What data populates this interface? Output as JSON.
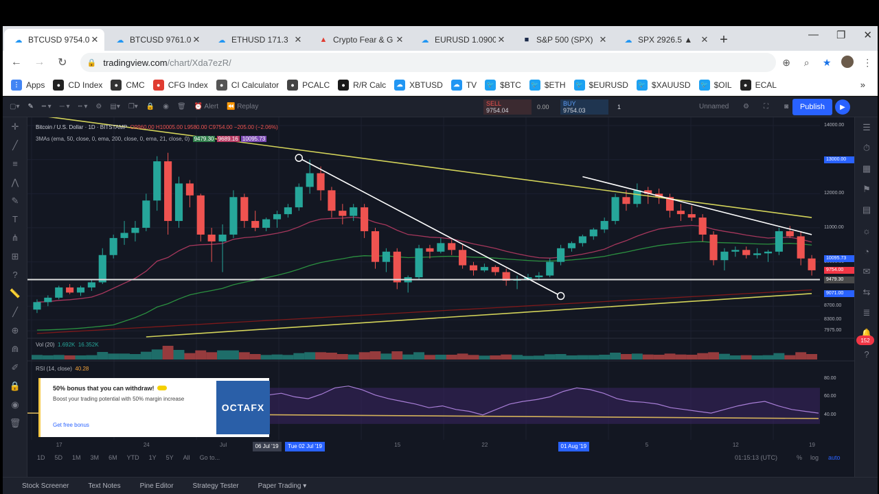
{
  "browser": {
    "tabs": [
      {
        "label": "BTCUSD 9754.0",
        "icon": "tradingview-icon",
        "active": true
      },
      {
        "label": "BTCUSD 9761.0",
        "icon": "tradingview-icon"
      },
      {
        "label": "ETHUSD 171.3",
        "icon": "tradingview-icon"
      },
      {
        "label": "Crypto Fear & G",
        "icon": "alternative-me-icon"
      },
      {
        "label": "EURUSD 1.0900",
        "icon": "tradingview-icon"
      },
      {
        "label": "S&P 500 (SPX)",
        "icon": "investing-icon"
      },
      {
        "label": "SPX 2926.5 ▲",
        "icon": "tradingview-icon"
      }
    ],
    "url_host": "tradingview.com",
    "url_path": "/chart/Xda7ezR/",
    "bookmarks": [
      {
        "label": "Apps",
        "icon": "apps-grid-icon",
        "color": "#4285f4"
      },
      {
        "label": "CD Index",
        "icon": "cd-index-icon",
        "color": "#222222"
      },
      {
        "label": "CMC",
        "icon": "coinmarketcap-icon",
        "color": "#333333"
      },
      {
        "label": "CFG Index",
        "icon": "cfg-index-icon",
        "color": "#e03c31"
      },
      {
        "label": "CI Calculator",
        "icon": "ci-calculator-icon",
        "color": "#555555"
      },
      {
        "label": "PCALC",
        "icon": "percent-icon",
        "color": "#444444"
      },
      {
        "label": "R/R Calc",
        "icon": "rr-calc-icon",
        "color": "#1a1a1a"
      },
      {
        "label": "XBTUSD",
        "icon": "tradingview-icon",
        "color": "#2196f3"
      },
      {
        "label": "TV",
        "icon": "tradingview-icon",
        "color": "#2196f3"
      },
      {
        "label": "$BTC",
        "icon": "twitter-icon",
        "color": "#1da1f2"
      },
      {
        "label": "$ETH",
        "icon": "twitter-icon",
        "color": "#1da1f2"
      },
      {
        "label": "$EURUSD",
        "icon": "twitter-icon",
        "color": "#1da1f2"
      },
      {
        "label": "$XAUUSD",
        "icon": "twitter-icon",
        "color": "#1da1f2"
      },
      {
        "label": "$OIL",
        "icon": "twitter-icon",
        "color": "#1da1f2"
      },
      {
        "label": "ECAL",
        "icon": "ecal-icon",
        "color": "#222222"
      }
    ]
  },
  "tv": {
    "toolbar": {
      "alert_label": "Alert",
      "replay_label": "Replay",
      "sell_label": "SELL",
      "sell_price": "9754.04",
      "spread": "0.00",
      "buy_label": "BUY",
      "buy_price": "9754.03",
      "qty": "1",
      "unnamed_label": "Unnamed",
      "publish_label": "Publish"
    },
    "legend": {
      "symbol": "Bitcoin / U.S. Dollar · 1D · BITSTAMP",
      "ohlc": "O9960.00  H10005.00  L9580.00  C9754.00  −205.00 (−2.06%)",
      "mas": "3MAs (ema, 50, close, 0, ema, 200, close, 0, ema, 21, close, 0)",
      "ma_values": [
        "9479.30",
        "9689.16",
        "10095.73"
      ]
    },
    "volume": {
      "label": "Vol (20)",
      "v1": "1.692K",
      "v2": "16.352K"
    },
    "rsi": {
      "label": "RSI (14, close)",
      "value": "40.28"
    },
    "ad": {
      "title": "50% bonus that you can withdraw!",
      "body": "Boost your trading potential with 50% margin increase",
      "link": "Get free bonus",
      "logo": "OCTAFX"
    },
    "price_axis": [
      "14000.00",
      "13000.00",
      "12000.00",
      "11000.00",
      "10000.00",
      "9000.00",
      "8700.00",
      "8300.00",
      "7975.00"
    ],
    "price_badges": [
      {
        "label": "13000.00",
        "color": "#2962ff"
      },
      {
        "label": "10095.73",
        "color": "#2962ff"
      },
      {
        "label": "9754.00",
        "color": "#f23645"
      },
      {
        "label": "9479.30",
        "color": "#4a4a4a"
      },
      {
        "label": "9071.00",
        "color": "#2962ff"
      }
    ],
    "rsi_axis": [
      "80.00",
      "60.00",
      "40.00"
    ],
    "time_axis": [
      "17",
      "24",
      "Jul",
      "8",
      "15",
      "22",
      "29",
      "5",
      "12",
      "19"
    ],
    "time_highlights": [
      "06 Jul '19",
      "Tue 02 Jul '19",
      "01 Aug '19"
    ],
    "ranges": [
      "1D",
      "5D",
      "1M",
      "3M",
      "6M",
      "YTD",
      "1Y",
      "5Y",
      "All",
      "Go to..."
    ],
    "clock": "01:15:13 (UTC)",
    "scale_modes": [
      "%",
      "log",
      "auto"
    ],
    "notification_count": "152",
    "footer_tabs": [
      "Stock Screener",
      "Text Notes",
      "Pine Editor",
      "Strategy Tester",
      "Paper Trading ▾"
    ]
  },
  "chart_data": {
    "type": "candlestick",
    "symbol": "Bitcoin / U.S. Dollar",
    "interval": "1D",
    "exchange": "BITSTAMP",
    "ylim": [
      7800,
      14200
    ],
    "colors": {
      "up": "#26a69a",
      "down": "#ef5350",
      "trendline": "#ffffff",
      "channel": "#d4d45a"
    },
    "candles": [
      {
        "o": 8600,
        "h": 8900,
        "l": 8500,
        "c": 8820
      },
      {
        "o": 8820,
        "h": 9020,
        "l": 8700,
        "c": 8950
      },
      {
        "o": 8950,
        "h": 9300,
        "l": 8900,
        "c": 9250
      },
      {
        "o": 9250,
        "h": 9350,
        "l": 9050,
        "c": 9100
      },
      {
        "o": 9100,
        "h": 9300,
        "l": 9000,
        "c": 9250
      },
      {
        "o": 9250,
        "h": 9500,
        "l": 9150,
        "c": 9400
      },
      {
        "o": 9400,
        "h": 10400,
        "l": 9350,
        "c": 10200
      },
      {
        "o": 10200,
        "h": 10800,
        "l": 10100,
        "c": 10700
      },
      {
        "o": 10700,
        "h": 11200,
        "l": 10500,
        "c": 10850
      },
      {
        "o": 10850,
        "h": 11200,
        "l": 10600,
        "c": 11000
      },
      {
        "o": 11000,
        "h": 12000,
        "l": 10900,
        "c": 11800
      },
      {
        "o": 11800,
        "h": 13100,
        "l": 11500,
        "c": 12950
      },
      {
        "o": 12950,
        "h": 13200,
        "l": 10800,
        "c": 11200
      },
      {
        "o": 11200,
        "h": 12500,
        "l": 11000,
        "c": 12300
      },
      {
        "o": 12300,
        "h": 12400,
        "l": 11600,
        "c": 11950
      },
      {
        "o": 11950,
        "h": 12000,
        "l": 10600,
        "c": 10800
      },
      {
        "o": 10800,
        "h": 11000,
        "l": 10000,
        "c": 10600
      },
      {
        "o": 10600,
        "h": 11100,
        "l": 9700,
        "c": 10800
      },
      {
        "o": 10800,
        "h": 12100,
        "l": 10700,
        "c": 11900
      },
      {
        "o": 11900,
        "h": 12000,
        "l": 11000,
        "c": 11200
      },
      {
        "o": 11200,
        "h": 11500,
        "l": 10900,
        "c": 11000
      },
      {
        "o": 11000,
        "h": 11300,
        "l": 10900,
        "c": 11250
      },
      {
        "o": 11250,
        "h": 11500,
        "l": 11000,
        "c": 11400
      },
      {
        "o": 11400,
        "h": 11700,
        "l": 11300,
        "c": 11600
      },
      {
        "o": 11600,
        "h": 12300,
        "l": 11500,
        "c": 12200
      },
      {
        "o": 12200,
        "h": 13000,
        "l": 12000,
        "c": 12600
      },
      {
        "o": 12600,
        "h": 12800,
        "l": 11800,
        "c": 12100
      },
      {
        "o": 12100,
        "h": 12200,
        "l": 11300,
        "c": 11500
      },
      {
        "o": 11500,
        "h": 11700,
        "l": 11100,
        "c": 11350
      },
      {
        "o": 11350,
        "h": 11700,
        "l": 11200,
        "c": 11600
      },
      {
        "o": 11600,
        "h": 11700,
        "l": 10700,
        "c": 10900
      },
      {
        "o": 10900,
        "h": 11000,
        "l": 9800,
        "c": 10000
      },
      {
        "o": 10000,
        "h": 10400,
        "l": 9700,
        "c": 10300
      },
      {
        "o": 10300,
        "h": 10400,
        "l": 9200,
        "c": 9400
      },
      {
        "o": 9400,
        "h": 9600,
        "l": 9100,
        "c": 9550
      },
      {
        "o": 9550,
        "h": 10500,
        "l": 9500,
        "c": 10400
      },
      {
        "o": 10400,
        "h": 10500,
        "l": 10100,
        "c": 10300
      },
      {
        "o": 10300,
        "h": 10700,
        "l": 10250,
        "c": 10550
      },
      {
        "o": 10550,
        "h": 10650,
        "l": 10200,
        "c": 10350
      },
      {
        "o": 10350,
        "h": 10500,
        "l": 9800,
        "c": 9900
      },
      {
        "o": 9900,
        "h": 10000,
        "l": 9600,
        "c": 9750
      },
      {
        "o": 9750,
        "h": 9950,
        "l": 9700,
        "c": 9850
      },
      {
        "o": 9850,
        "h": 9900,
        "l": 9600,
        "c": 9700
      },
      {
        "o": 9700,
        "h": 9800,
        "l": 9300,
        "c": 9450
      },
      {
        "o": 9450,
        "h": 9600,
        "l": 9200,
        "c": 9500
      },
      {
        "o": 9500,
        "h": 9650,
        "l": 9450,
        "c": 9550
      },
      {
        "o": 9550,
        "h": 9700,
        "l": 9450,
        "c": 9600
      },
      {
        "o": 9600,
        "h": 10100,
        "l": 9550,
        "c": 10000
      },
      {
        "o": 10000,
        "h": 10500,
        "l": 9900,
        "c": 10400
      },
      {
        "o": 10400,
        "h": 10600,
        "l": 10300,
        "c": 10550
      },
      {
        "o": 10550,
        "h": 10800,
        "l": 10450,
        "c": 10750
      },
      {
        "o": 10750,
        "h": 11000,
        "l": 10650,
        "c": 10950
      },
      {
        "o": 10950,
        "h": 11300,
        "l": 10850,
        "c": 11200
      },
      {
        "o": 11200,
        "h": 12000,
        "l": 11100,
        "c": 11900
      },
      {
        "o": 11900,
        "h": 12100,
        "l": 11500,
        "c": 11700
      },
      {
        "o": 11700,
        "h": 12300,
        "l": 11600,
        "c": 12100
      },
      {
        "o": 12100,
        "h": 12200,
        "l": 11700,
        "c": 12000
      },
      {
        "o": 12000,
        "h": 12150,
        "l": 11700,
        "c": 11900
      },
      {
        "o": 11900,
        "h": 12000,
        "l": 11300,
        "c": 11500
      },
      {
        "o": 11500,
        "h": 11700,
        "l": 11200,
        "c": 11400
      },
      {
        "o": 11400,
        "h": 11650,
        "l": 11200,
        "c": 11300
      },
      {
        "o": 11300,
        "h": 11400,
        "l": 10600,
        "c": 10800
      },
      {
        "o": 10800,
        "h": 10900,
        "l": 9900,
        "c": 10050
      },
      {
        "o": 10050,
        "h": 10400,
        "l": 9750,
        "c": 10300
      },
      {
        "o": 10300,
        "h": 10450,
        "l": 10150,
        "c": 10350
      },
      {
        "o": 10350,
        "h": 10450,
        "l": 10100,
        "c": 10200
      },
      {
        "o": 10200,
        "h": 10400,
        "l": 10100,
        "c": 10250
      },
      {
        "o": 10250,
        "h": 10350,
        "l": 10000,
        "c": 10300
      },
      {
        "o": 10300,
        "h": 11000,
        "l": 10200,
        "c": 10900
      },
      {
        "o": 10900,
        "h": 11050,
        "l": 10700,
        "c": 10750
      },
      {
        "o": 10750,
        "h": 10900,
        "l": 9900,
        "c": 10100
      },
      {
        "o": 10100,
        "h": 10200,
        "l": 9600,
        "c": 9754
      }
    ],
    "horizontal_levels": [
      9479.3
    ],
    "trendlines": [
      {
        "from": {
          "i": 0,
          "p": 14300
        },
        "to": {
          "i": 71,
          "p": 11300
        }
      },
      {
        "from": {
          "i": 10,
          "p": 7800
        },
        "to": {
          "i": 71,
          "p": 9071
        }
      },
      {
        "from": {
          "i": 24,
          "p": 13050
        },
        "to": {
          "i": 48,
          "p": 9000
        }
      },
      {
        "from": {
          "i": 50,
          "p": 12500
        },
        "to": {
          "i": 71,
          "p": 10800
        }
      }
    ],
    "rsi_values": [
      62,
      64,
      60,
      58,
      63,
      70,
      72,
      68,
      62,
      58,
      55,
      52,
      48,
      50,
      46,
      44,
      40,
      46,
      52,
      55,
      57,
      60,
      66,
      70,
      68,
      64,
      58,
      55,
      54,
      52,
      48,
      46,
      44,
      42,
      46,
      50,
      53,
      55,
      50,
      46,
      44,
      42
    ],
    "rsi_ylim": [
      20,
      90
    ]
  }
}
